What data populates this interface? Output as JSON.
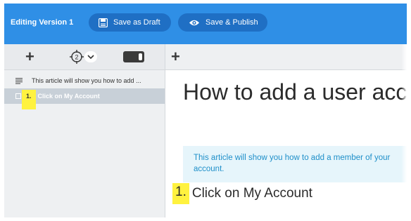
{
  "topbar": {
    "title": "Editing Version 1",
    "save_draft_label": "Save as Draft",
    "save_publish_label": "Save & Publish",
    "accent_color": "#2f8fe6"
  },
  "sidebar": {
    "target_count": "2",
    "outline": [
      {
        "icon": "lines-icon",
        "label": "This article will show you how to add ..."
      },
      {
        "icon": "checkbox-icon",
        "number": "1.",
        "label": "Click on My Account",
        "selected": true
      }
    ]
  },
  "main": {
    "heading": "How to add a user acco",
    "info_text": "This article will show you how to add a member of your account.",
    "step_number": "1.",
    "step_label": "Click on My Account"
  },
  "colors": {
    "highlight": "#fff23f",
    "info_bg": "#e6f5fb",
    "info_text": "#1e8fc9"
  }
}
